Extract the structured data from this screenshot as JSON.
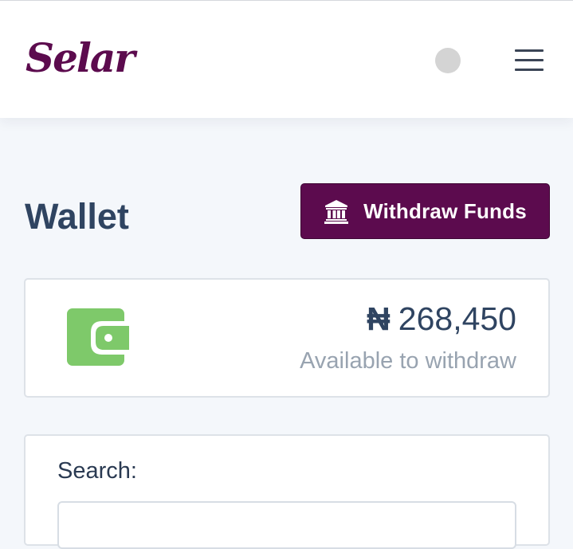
{
  "header": {
    "logo_text": "Selar",
    "brand_color": "#5c0b4e",
    "avatar_icon": "user-avatar",
    "menu_icon": "hamburger-menu-icon"
  },
  "page": {
    "title": "Wallet",
    "background": "#f4f7fb"
  },
  "withdraw": {
    "label": "Withdraw Funds",
    "icon": "bank-icon",
    "color": "#5c0b4e"
  },
  "balance": {
    "currency_symbol": "₦",
    "amount": "268,450",
    "caption": "Available to withdraw",
    "icon": "wallet-icon",
    "icon_color": "#7ec96a"
  },
  "search": {
    "label": "Search:",
    "value": "",
    "placeholder": ""
  }
}
